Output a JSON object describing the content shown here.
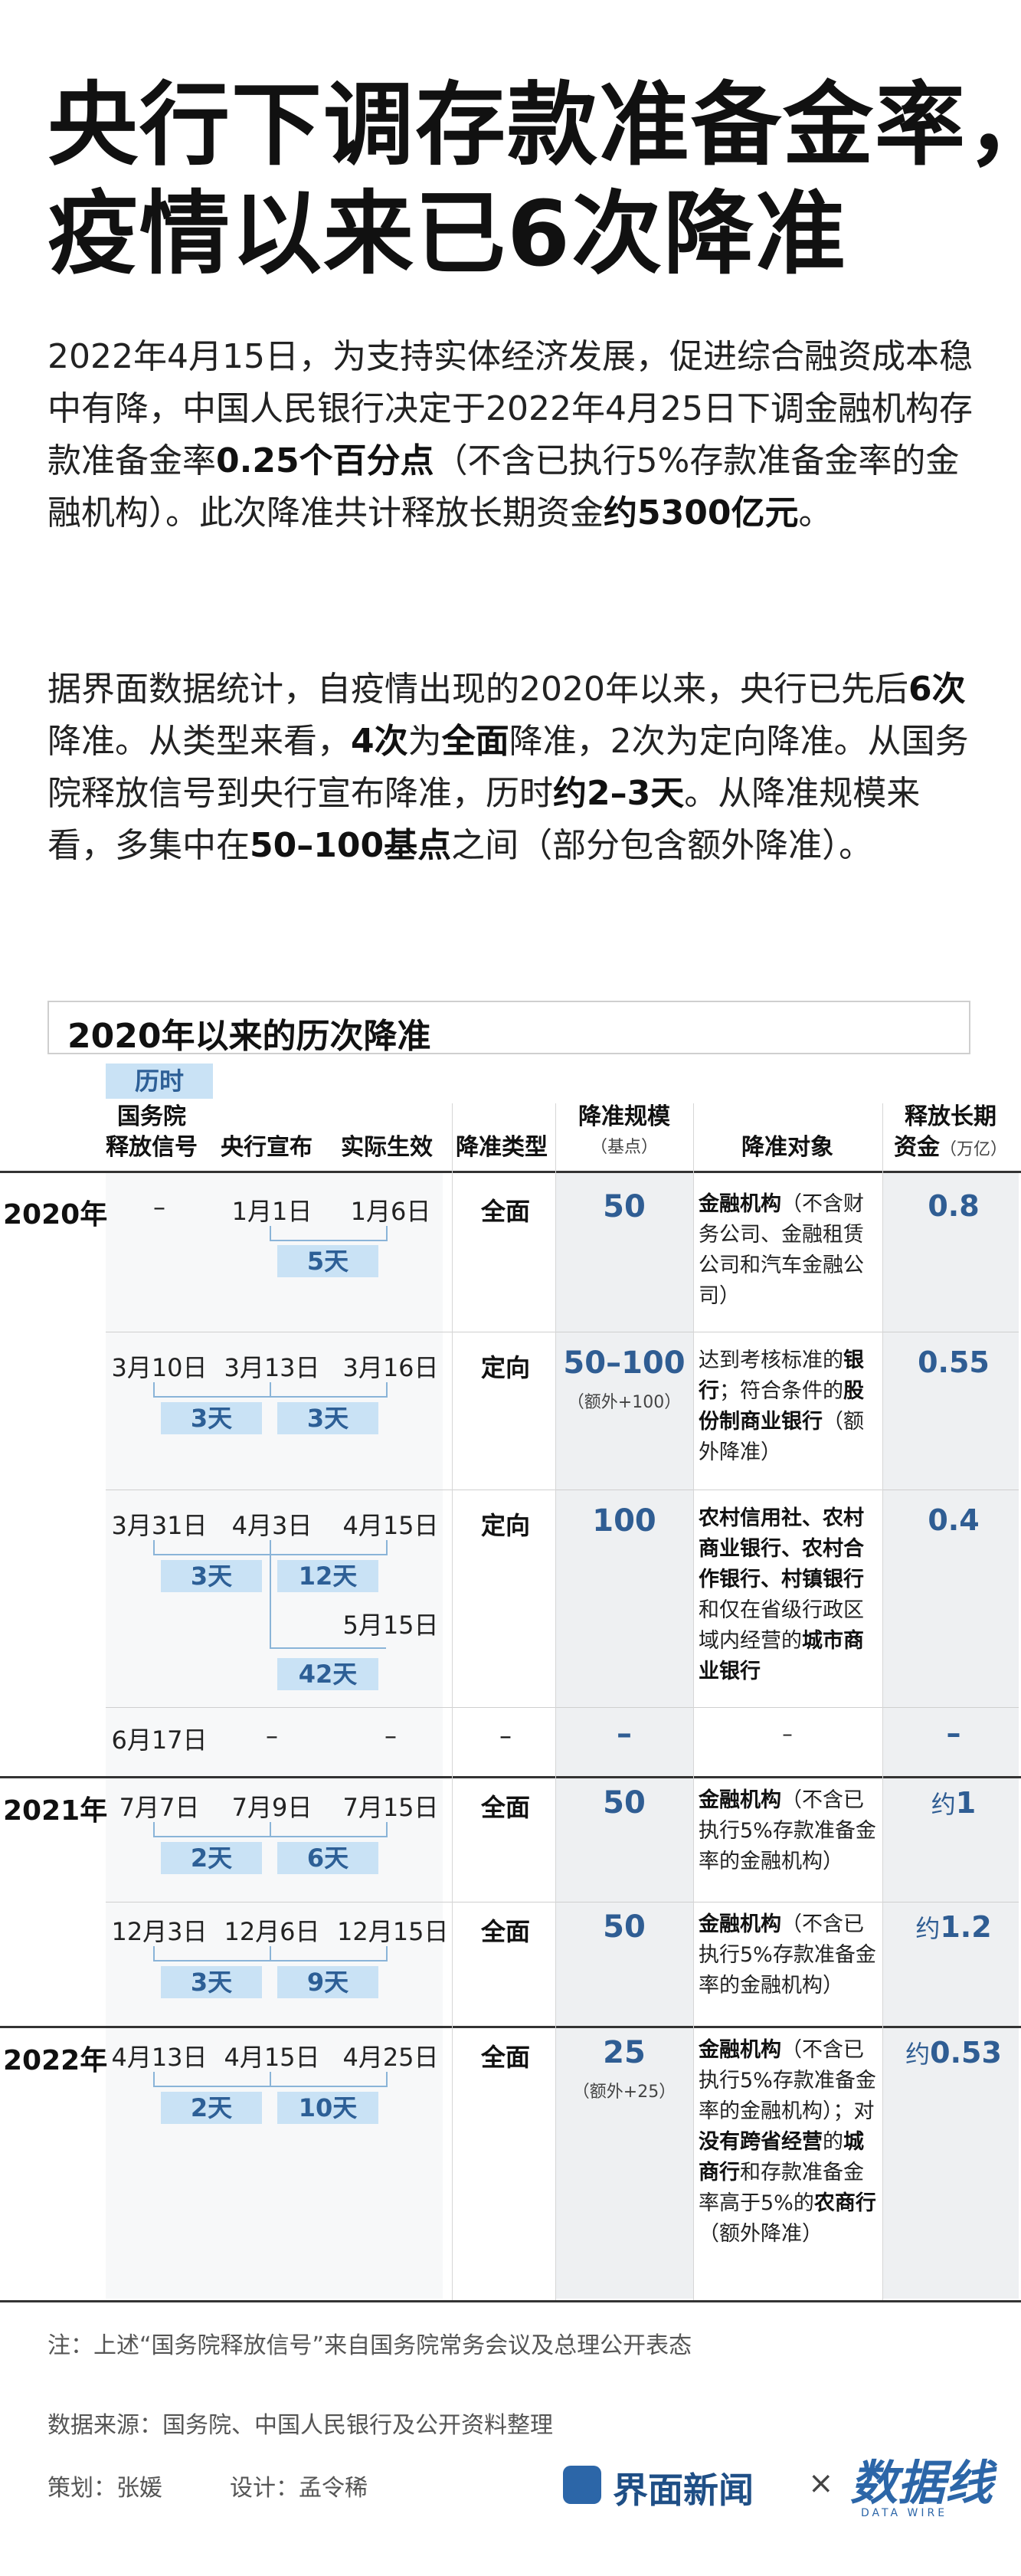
{
  "headline": {
    "line1": "央行下调存款准备金率，",
    "line2": "疫情以来已6次降准"
  },
  "intro": {
    "p1_a": "2022年4月15日，为支持实体经济发展，促进综合融资成本稳中有降，中国人民银行决定于2022年4月25日下调金融机构存款准备金率",
    "p1_b": "0.25个百分点",
    "p1_c": "（不含已执行5%存款准备金率的金融机构）。此次降准共计释放长期资金",
    "p1_d": "约5300亿元",
    "p1_e": "。",
    "p2_a": "据界面数据统计，自疫情出现的2020年以来，央行已先后",
    "p2_b": "6次",
    "p2_c": "降准。从类型来看，",
    "p2_d": "4次",
    "p2_e": "为",
    "p2_f": "全面",
    "p2_g": "降准，2次为定向降准。从国务院释放信号到央行宣布降准，历时",
    "p2_h": "约2–3天",
    "p2_i": "。从降准规模来看，多集中在",
    "p2_j": "50–100基点",
    "p2_k": "之间（部分包含额外降准）。"
  },
  "table": {
    "title": "2020年以来的历次降准",
    "duration_label": "历时",
    "headers": {
      "signal_1": "国务院",
      "signal_2": "释放信号",
      "announce": "央行宣布",
      "effective": "实际生效",
      "type": "降准类型",
      "scale": "降准规模",
      "scale_unit": "（基点）",
      "target": "降准对象",
      "release_1": "释放长期",
      "release_2": "资金",
      "release_unit": "（万亿）"
    },
    "years": [
      "2020年",
      "2021年",
      "2022年"
    ],
    "rows": [
      {
        "signal": "–",
        "announce": "1月1日",
        "effective": "1月6日",
        "type": "全面",
        "scale": "50",
        "scale_sub": "",
        "release": "0.8",
        "release_prefix": "",
        "d1": "5天",
        "d2": ""
      },
      {
        "signal": "3月10日",
        "announce": "3月13日",
        "effective": "3月16日",
        "type": "定向",
        "scale": "50–100",
        "scale_sub": "（额外+100）",
        "release": "0.55",
        "release_prefix": "",
        "d1": "3天",
        "d2": "3天"
      },
      {
        "signal": "3月31日",
        "announce": "4月3日",
        "effective": "4月15日",
        "effective2": "5月15日",
        "type": "定向",
        "scale": "100",
        "scale_sub": "",
        "release": "0.4",
        "release_prefix": "",
        "d1": "3天",
        "d2": "12天",
        "d3": "42天"
      },
      {
        "signal": "6月17日",
        "announce": "–",
        "effective": "–",
        "type": "–",
        "scale": "–",
        "scale_sub": "",
        "target": "–",
        "release": "–",
        "release_prefix": ""
      },
      {
        "signal": "7月7日",
        "announce": "7月9日",
        "effective": "7月15日",
        "type": "全面",
        "scale": "50",
        "scale_sub": "",
        "release": "1",
        "release_prefix": "约",
        "d1": "2天",
        "d2": "6天"
      },
      {
        "signal": "12月3日",
        "announce": "12月6日",
        "effective": "12月15日",
        "type": "全面",
        "scale": "50",
        "scale_sub": "",
        "release": "1.2",
        "release_prefix": "约",
        "d1": "3天",
        "d2": "9天"
      },
      {
        "signal": "4月13日",
        "announce": "4月15日",
        "effective": "4月25日",
        "type": "全面",
        "scale": "25",
        "scale_sub": "（额外+25）",
        "release": "0.53",
        "release_prefix": "约",
        "d1": "2天",
        "d2": "10天"
      }
    ],
    "targets": {
      "r0_b": "金融机构",
      "r0_n": "（不含财务公司、金融租赁公司和汽车金融公司）",
      "r1_a": "达到考核标准的",
      "r1_b": "银行",
      "r1_c": "；符合条件的",
      "r1_d": "股份制商业银行",
      "r1_e": "（额外降准）",
      "r2_b1": "农村信用社、农村商业银行、农村合作银行、村镇银行",
      "r2_n": "和仅在省级行政区域内经营的",
      "r2_b2": "城市商业银行",
      "r4_b": "金融机构",
      "r4_n": "（不含已执行5%存款准备金率的金融机构）",
      "r5_b": "金融机构",
      "r5_n": "（不含已执行5%存款准备金率的金融机构）",
      "r6_b": "金融机构",
      "r6_n1": "（不含已执行5%存款准备金率的金融机构）；对",
      "r6_b2": "没有跨省经营",
      "r6_n2": "的",
      "r6_b3": "城商行",
      "r6_n3": "和存款准备金率高于5%的",
      "r6_b4": "农商行",
      "r6_n4": "（额外降准）"
    }
  },
  "footer": {
    "note": "注：上述“国务院释放信号”来自国务院常务会议及总理公开表态",
    "source": "数据来源：国务院、中国人民银行及公开资料整理",
    "planner": "策划：张媛",
    "designer": "设计：孟令稀",
    "brand": "界面新闻",
    "times": "×",
    "dw": "数据线",
    "dw_sub": "DATA WIRE"
  }
}
